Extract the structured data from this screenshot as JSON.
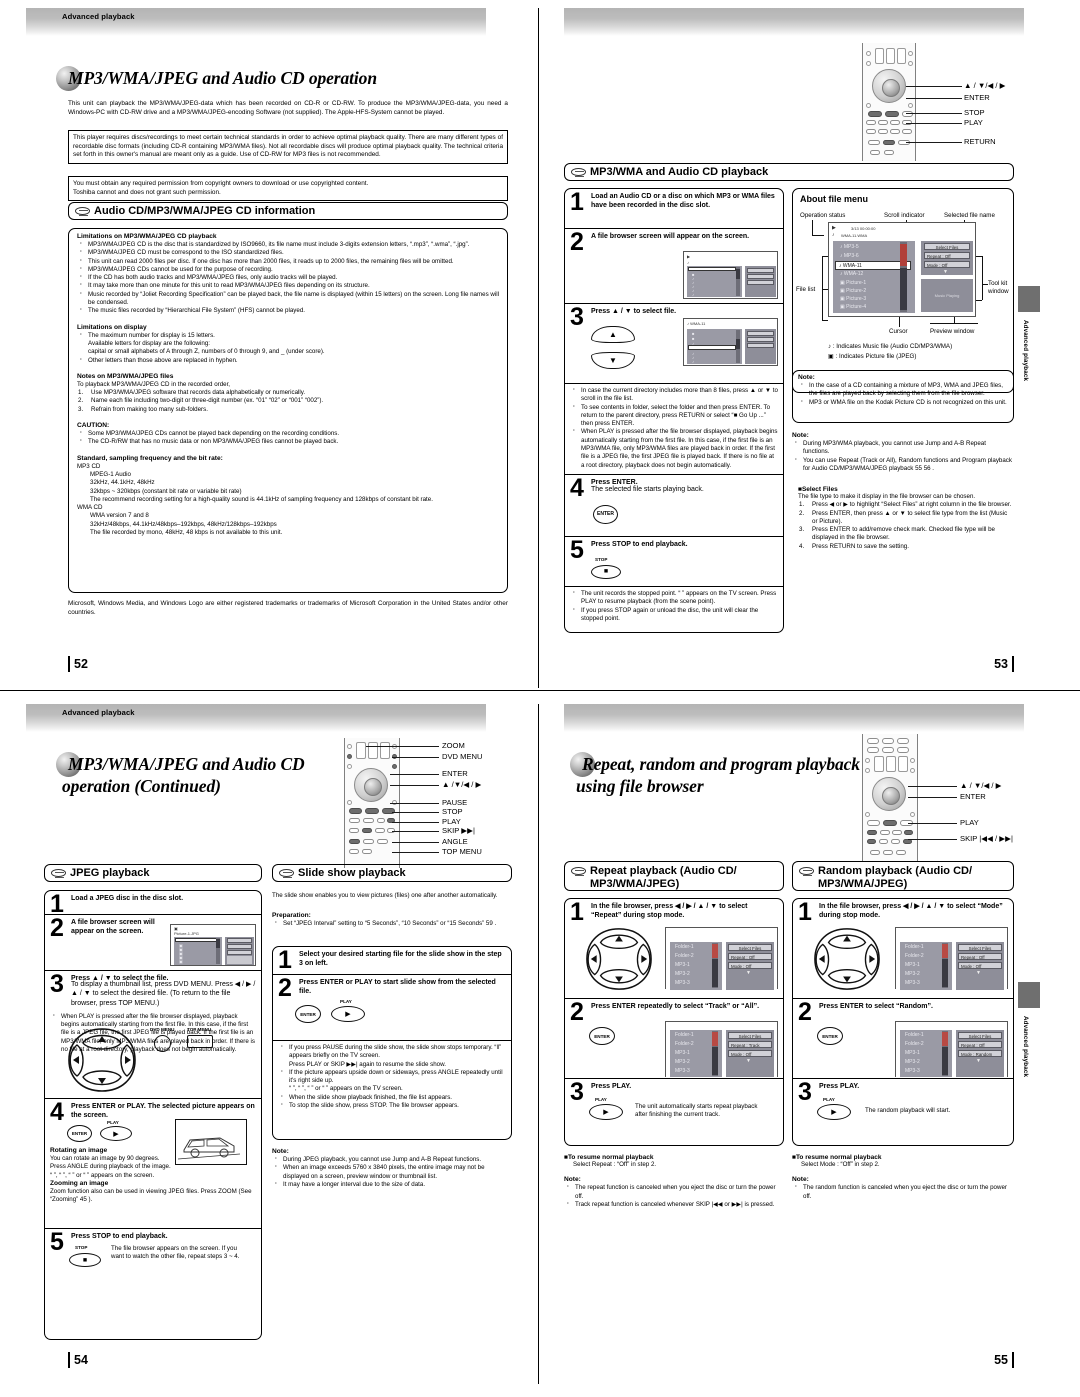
{
  "document": {
    "running_head": "Advanced playback",
    "side_tab": "Advanced playback"
  },
  "pages": [
    {
      "folio": "52",
      "title": "MP3/WMA/JPEG and Audio CD operation",
      "intro": "This unit can playback the MP3/WMA/JPEG-data which has been recorded on CD-R or CD-RW. To produce the  MP3/WMA/JPEG-data, you need a Windows-PC with CD-RW drive and a MP3/WMA/JPEG-encoding Software (not supplied). The Apple-HFS-System cannot be played.",
      "box1": "This player requires discs/recordings to meet certain technical standards in order to achieve optimal playback quality. There are many different types of recordable disc formats (including CD-R containing MP3/WMA files). Not all recordable discs will produce optimal playback quality. The technical criteria set forth in this owner's manual are meant only as a guide. Use of CD-RW for MP3 files is not recommended.",
      "box2": "You must obtain any required permission from copyright owners to download or use copyrighted content.\nToshiba cannot and does not grant such permission.",
      "section_title": "Audio CD/MP3/WMA/JPEG CD information",
      "limitations_playback_heading": "Limitations on MP3/WMA/JPEG CD playback",
      "limitations_playback": [
        "MP3/WMA/JPEG CD is the disc that is standardized by ISO9660, its file name must include 3-digits extension letters, “.mp3”, “.wma”, “.jpg”.",
        "MP3/WMA/JPEG CD must be correspond to the ISO standardized files.",
        "This unit can read 2000 files per disc. If one disc has more than 2000 files, it reads up to 2000 files, the remaining files will be omitted.",
        "MP3/WMA/JPEG CDs cannot be used for the purpose of recording.",
        "If the CD has both audio tracks and MP3/WMA/JPEG files, only audio tracks will be played.",
        "It may take more than one minute for this unit to read MP3/WMA/JPEG files depending on its structure.",
        "Music recorded by “Joliet Recording Specification” can be played back, the file name is displayed (within 15 letters) on the screen. Long file names will be condensed.",
        "The music files recorded by “Hierarchical File System” (HFS) cannot be played."
      ],
      "limitations_display_heading": "Limitations on display",
      "limitations_display": [
        "The maximum number for display is 15 letters.\nAvailable letters for display are the following:\ncapital or small alphabets of A through Z, numbers of 0 through 9, and _ (under score).",
        "Other letters than those above are replaced in hyphen."
      ],
      "notes_files_heading": "Notes on MP3/WMA/JPEG files",
      "notes_files_lead": "To playback MP3/WMA/JPEG CD in the recorded order,",
      "notes_files": [
        "Use MP3/WMA/JPEG software that records data alphabetically or numerically.",
        "Name each file including two-digit or three-digit number (ex. “01” “02” or “001” “002”).",
        "Refrain from making too many sub-folders."
      ],
      "caution_heading": "CAUTION:",
      "caution": [
        "Some MP3/WMA/JPEG CDs cannot be played back depending on the recording conditions.",
        "The CD-R/RW that has no music data or non MP3/WMA/JPEG files cannot be played back."
      ],
      "standard_heading": "Standard, sampling frequency and the bit rate:",
      "standard_mp3_label": "MP3 CD",
      "standard_mp3_lines": [
        "MPEG-1 Audio",
        "32kHz, 44.1kHz, 48kHz",
        "32kbps ~ 320kbps (constant bit rate or variable bit rate)",
        "The recommend recording setting for a high-quality sound is 44.1kHz of sampling frequency and 128kbps of constant bit rate."
      ],
      "standard_wma_label": "WMA CD",
      "standard_wma_lines": [
        "WMA version 7 and 8",
        "32kHz/48kbps, 44.1kHz/48kbps–192kbps, 48kHz/128kbps–192kbps",
        "The file recorded by mono, 48kHz, 48 kbps is not available to this unit."
      ],
      "trademark": "Microsoft, Windows Media, and Windows Logo are either registered trademarks or trademarks of Microsoft Corporation in the United States and/or other countries."
    },
    {
      "folio": "53",
      "section_title": "MP3/WMA and Audio CD playback",
      "remote_labels": [
        "▲ / ▼/◀ / ▶",
        "ENTER",
        "STOP",
        "PLAY",
        "RETURN"
      ],
      "steps": [
        {
          "n": "1",
          "text": "Load an Audio CD or a disc on which MP3 or WMA files have been recorded in the disc slot."
        },
        {
          "n": "2",
          "text": "A file browser screen will appear on the screen."
        },
        {
          "n": "3",
          "text": "Press ▲ / ▼ to select file."
        },
        {
          "n": "4",
          "text": "Press ENTER.",
          "sub": "The selected file starts playing back."
        },
        {
          "n": "5",
          "text": "Press STOP to end playback.",
          "caption": "STOP"
        }
      ],
      "step3_notes": [
        "In case the current directory includes more than 8 files, press ▲ or ▼ to scroll in the file list.",
        "To see contents in folder, select the folder and then press ENTER. To return to the parent directory, press RETURN or select “■ Go Up ...” then press ENTER.",
        "When PLAY is pressed after the file browser displayed, playback begins automatically starting from the first file. In this case, if the first file is an MP3/WMA file, only MP3/WMA files are played back in order. If the first file is a JPEG file, the first JPEG file is played back. If there is no file at a root directory, playback does not begin automatically."
      ],
      "step5_notes": [
        "The unit records the stopped point. “ ” appears on the TV screen. Press PLAY to resume playback (from the scene point).",
        "If you press STOP again or unload the disc, the unit will clear the stopped point."
      ],
      "about_menu": {
        "heading": "About file menu",
        "callouts": {
          "operation_status": "Operation status",
          "scroll_indicator": "Scroll indicator",
          "selected_file_name": "Selected file name",
          "file_list": "File list",
          "toolkit_window": "Tool kit\nwindow",
          "cursor": "Cursor",
          "preview_window": "Preview window"
        },
        "osd": {
          "status_line1": "3/13   00:00:00",
          "status_line2": "WMA-11.WMA",
          "files": [
            "MP3-5",
            "MP3-6",
            "WMA-11",
            "WMA-12",
            "Picture-1",
            "Picture-2",
            "Picture-3",
            "Picture-4"
          ],
          "selected_index": 2,
          "toolkit": [
            {
              "label": "Select Files",
              "value": ""
            },
            {
              "label": "Repeat",
              "value": ": Off"
            },
            {
              "label": "Mode",
              "value": ": Off"
            }
          ],
          "preview": "Music Playing"
        },
        "legend": [
          "♪ : Indicates Music file (Audio CD/MP3/WMA)",
          "▣ : Indicates Picture file (JPEG)"
        ]
      },
      "note_box": {
        "title": "Note:",
        "items": [
          "In the case of a CD containing a mixture of MP3, WMA and JPEG files, the files are played back by selecting them from the file browser.",
          "MP3 or WMA file on the Kodak Picture CD is not recognized on this unit."
        ]
      },
      "note_plain": {
        "title": "Note:",
        "items": [
          "During MP3/WMA playback, you cannot use Jump and A-B Repeat functions.",
          "You can use Repeat (Track or All), Random functions and Program playback for Audio CD/MP3/WMA/JPEG playback 55 56 ."
        ]
      },
      "select_files": {
        "heading": "Select Files",
        "lead": "The file type to make it display in the file browser can be chosen.",
        "steps": [
          "Press ◀ or ▶ to highlight “Select Files” at right column in the file browser.",
          "Press ENTER, then press ▲ or ▼ to select file type from the list (Music or Picture).",
          "Press ENTER to add/remove check mark. Checked file type will be displayed in the file browser.",
          "Press RETURN to save the setting."
        ]
      }
    },
    {
      "folio": "54",
      "title_line1": "MP3/WMA/JPEG and Audio CD",
      "title_line2": "operation (Continued)",
      "remote_labels": [
        "ZOOM",
        "DVD MENU",
        "ENTER",
        "▲ /▼/◀ / ▶",
        "PAUSE",
        "STOP",
        "PLAY",
        "SKIP ▶▶|",
        "ANGLE",
        "TOP MENU"
      ],
      "left_section_title": "JPEG playback",
      "right_section_title": "Slide show playback",
      "jpeg_steps": [
        {
          "n": "1",
          "text": "Load a JPEG disc in the disc slot."
        },
        {
          "n": "2",
          "text": "A file browser screen will appear on the screen."
        },
        {
          "n": "3",
          "text": "Press ▲ / ▼ to select the file.",
          "sub": "To display a thumbnail list, press DVD MENU. Press ◀ / ▶ / ▲ / ▼ to select the desired file. (To return to the file browser, press TOP MENU.)"
        },
        {
          "n": "4",
          "text": "Press ENTER or PLAY. The selected picture appears on the screen."
        },
        {
          "n": "5",
          "text": "Press STOP to end playback.",
          "sub": "The file browser appears on the screen. If you want to watch the other file, repeat steps 3 ~ 4.",
          "caption": "STOP"
        }
      ],
      "jpeg_step3_note": "When PLAY is pressed after the file browser displayed, playback begins automatically starting from the first file. In this case, if the first file is a JPEG file, the first JPEG file is played back. If the first file is an MP3/WMA file, only MP3/WMA files are played back in order. If there is no file at a root directory, playback does not begin automatically.",
      "rotating_heading": "Rotating an image",
      "rotating_text": "You can rotate an image by 90 degrees.\nPress ANGLE during playback of the image.",
      "rotating_icons": "“ ”, “ ”, “ ” or “ ” appears on the screen.",
      "zooming_heading": "Zooming an image",
      "zooming_text": "Zoom function also can be used in viewing JPEG files. Press ZOOM (See “Zooming” 45 ).",
      "slide_intro": "The slide show enables you to view pictures (files) one after another automatically.",
      "prep_heading": "Preparation:",
      "prep_text": "Set “JPEG Interval” setting to “5 Seconds”, “10 Seconds” or “15 Seconds” 59 .",
      "slide_steps": [
        {
          "n": "1",
          "text": "Select your desired starting file for the slide show in the step 3 on left."
        },
        {
          "n": "2",
          "text": "Press ENTER or PLAY to start slide show from the selected file."
        }
      ],
      "slide_notes": [
        "If you press PAUSE during the slide show, the slide show stops temporary. “‖” appears briefly on the TV screen.\nPress PLAY or SKIP ▶▶| again to resume the slide show.",
        "If the picture appears upside down or sideways, press ANGLE repeatedly until it's right side up.\n“ ”, “ ”, “ ” or “ ” appears on the TV screen.",
        "When the slide show playback finished, the file list appears.",
        "To stop the slide show, press STOP. The file browser appears."
      ],
      "slide_note_block": {
        "title": "Note:",
        "items": [
          "During JPEG playback, you cannot use Jump and A-B Repeat functions.",
          "When an image exceeds 5760 x 3840 pixels, the entire image may not be displayed on a screen, preview window or thumbnail list.",
          "It may have a longer interval due to the size of data."
        ]
      }
    },
    {
      "folio": "55",
      "title_line1": "Repeat, random and program playback",
      "title_line2": "using file browser",
      "remote_labels": [
        "▲ / ▼/◀ / ▶",
        "ENTER",
        "PLAY",
        "SKIP |◀◀ / ▶▶|"
      ],
      "left_section_title_line1": "Repeat playback (Audio CD/",
      "left_section_title_line2": "MP3/WMA/JPEG)",
      "right_section_title_line1": "Random playback (Audio CD/",
      "right_section_title_line2": "MP3/WMA/JPEG)",
      "repeat_steps": [
        {
          "n": "1",
          "text": "In the file browser, press ◀ / ▶ / ▲ / ▼ to select “Repeat” during stop mode."
        },
        {
          "n": "2",
          "text": "Press ENTER repeatedly to select “Track” or “All”."
        },
        {
          "n": "3",
          "text": "Press PLAY.",
          "sub": "The unit automatically starts repeat playback after finishing the current track."
        }
      ],
      "random_steps": [
        {
          "n": "1",
          "text": "In the file browser, press ◀ / ▶ / ▲ / ▼ to select “Mode” during stop mode."
        },
        {
          "n": "2",
          "text": "Press ENTER to select “Random”."
        },
        {
          "n": "3",
          "text": "Press PLAY.",
          "sub": "The random playback will start."
        }
      ],
      "repeat_osd_files": [
        "Folder-1",
        "Folder-2",
        "MP3-1",
        "MP3-2",
        "MP3-3"
      ],
      "repeat_osd_tk1": [
        {
          "label": "Select Files",
          "value": ""
        },
        {
          "label": "Repeat",
          "value": ": Off"
        },
        {
          "label": "Mode",
          "value": ": Off"
        }
      ],
      "repeat_osd_tk2": [
        {
          "label": "Select Files",
          "value": ""
        },
        {
          "label": "Repeat",
          "value": ": Track"
        },
        {
          "label": "Mode",
          "value": ": Off"
        }
      ],
      "random_osd_tk1": [
        {
          "label": "Select Files",
          "value": ""
        },
        {
          "label": "Repeat",
          "value": ": Off"
        },
        {
          "label": "Mode",
          "value": ": Off"
        }
      ],
      "random_osd_tk2": [
        {
          "label": "Select Files",
          "value": ""
        },
        {
          "label": "Repeat",
          "value": ": Off"
        },
        {
          "label": "Mode",
          "value": ": Random"
        }
      ],
      "repeat_resume": {
        "heading": "To resume normal playback",
        "text": "Select Repeat : “Off” in step 2."
      },
      "random_resume": {
        "heading": "To resume normal playback",
        "text": "Select Mode : “Off” in step 2."
      },
      "repeat_note": {
        "title": "Note:",
        "items": [
          "The repeat function is canceled when you eject the disc or turn the power off.",
          "Track repeat function is canceled whenever SKIP |◀◀ or ▶▶| is pressed."
        ]
      },
      "random_note": {
        "title": "Note:",
        "items": [
          "The random function is canceled when you eject the disc or turn the power off."
        ]
      }
    }
  ]
}
